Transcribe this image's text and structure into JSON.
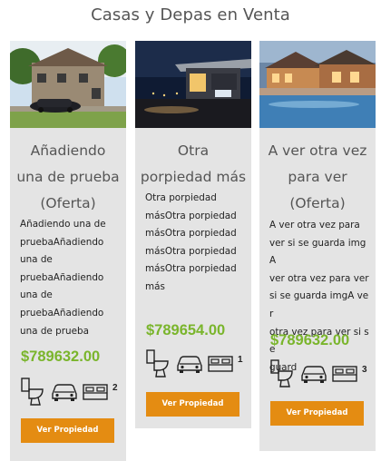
{
  "page": {
    "title": "Casas y Depas en Venta"
  },
  "theme": {
    "accent": "#e48c12",
    "price_color": "#7ab52c",
    "card_bg": "#e4e4e4"
  },
  "icons": [
    "toilet-icon",
    "car-icon",
    "bed-icon"
  ],
  "cards": [
    {
      "heading_lines": [
        "Añadiendo",
        "una de prueba",
        "(Oferta)"
      ],
      "description_lines": [
        "Añadiendo una de",
        "pruebaAñadiendo",
        "una de",
        "pruebaAñadiendo",
        "una de",
        "pruebaAñadiendo",
        "una de prueba"
      ],
      "price": "$789632.00",
      "count": "2",
      "button_label": "Ver Propiedad",
      "photo": "house-exterior-photo"
    },
    {
      "heading_lines": [
        "Otra",
        "porpiedad más"
      ],
      "description_lines": [
        "Otra porpiedad",
        "másOtra porpiedad",
        "másOtra porpiedad",
        "másOtra porpiedad",
        "másOtra porpiedad",
        "más"
      ],
      "price": "$789654.00",
      "count": "1",
      "button_label": "Ver Propiedad",
      "photo": "night-modern-house-photo"
    },
    {
      "heading_lines": [
        "A ver otra vez",
        "para ver",
        "(Oferta)"
      ],
      "description_lines": [
        "A ver otra vez para",
        "ver si se guarda imgA",
        "ver otra vez para ver",
        "si se guarda imgA ver",
        "otra vez para ver si se",
        "guard"
      ],
      "price": "$789632.00",
      "count": "3",
      "button_label": "Ver Propiedad",
      "photo": "resort-pool-photo"
    }
  ]
}
